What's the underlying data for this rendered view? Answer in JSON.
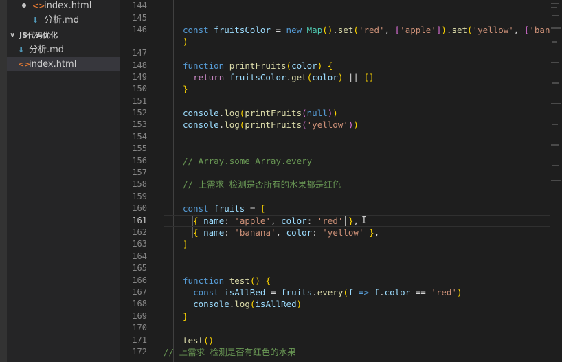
{
  "sidebar": {
    "items": [
      {
        "type": "file",
        "icon": "html-file-icon",
        "label": "index.html",
        "modified": true
      },
      {
        "type": "file",
        "icon": "markdown-file-icon",
        "label": "分析.md"
      },
      {
        "type": "folder",
        "icon": "chevron-down-icon",
        "label": "JS代码优化"
      },
      {
        "type": "file",
        "icon": "markdown-file-icon",
        "label": "分析.md"
      },
      {
        "type": "file",
        "icon": "html-file-icon",
        "label": "index.html",
        "selected": true
      }
    ]
  },
  "editor": {
    "active_line": "161",
    "lines": [
      {
        "n": "144",
        "t": ""
      },
      {
        "n": "145",
        "t": ""
      },
      {
        "n": "146",
        "t": "const fruitsColor = new Map().set('red', ['apple']).set('yellow', ['banana']"
      },
      {
        "n": "",
        "t": ")"
      },
      {
        "n": "147",
        "t": ""
      },
      {
        "n": "148",
        "t": "function printFruits(color) {"
      },
      {
        "n": "149",
        "t": "  return fruitsColor.get(color) || []"
      },
      {
        "n": "150",
        "t": "}"
      },
      {
        "n": "151",
        "t": ""
      },
      {
        "n": "152",
        "t": "console.log(printFruits(null))"
      },
      {
        "n": "153",
        "t": "console.log(printFruits('yellow'))"
      },
      {
        "n": "154",
        "t": ""
      },
      {
        "n": "155",
        "t": ""
      },
      {
        "n": "156",
        "t": "// Array.some Array.every"
      },
      {
        "n": "157",
        "t": ""
      },
      {
        "n": "158",
        "t": "// 上需求 检测是否所有的水果都是红色"
      },
      {
        "n": "159",
        "t": ""
      },
      {
        "n": "160",
        "t": "const fruits = ["
      },
      {
        "n": "161",
        "t": "  { name: 'apple', color: 'red' },"
      },
      {
        "n": "162",
        "t": "  { name: 'banana', color: 'yellow' },"
      },
      {
        "n": "163",
        "t": "]"
      },
      {
        "n": "164",
        "t": ""
      },
      {
        "n": "165",
        "t": ""
      },
      {
        "n": "166",
        "t": "function test() {"
      },
      {
        "n": "167",
        "t": "  const isAllRed = fruits.every(f => f.color == 'red')"
      },
      {
        "n": "168",
        "t": "  console.log(isAllRed)"
      },
      {
        "n": "169",
        "t": "}"
      },
      {
        "n": "170",
        "t": ""
      },
      {
        "n": "171",
        "t": "test()"
      },
      {
        "n": "172",
        "t": "// 上需求 检测是否有红色的水果"
      }
    ]
  },
  "colors": {
    "keyword": "#569cd6",
    "variable": "#9cdcfe",
    "function": "#dcdcaa",
    "class": "#4ec9b0",
    "string": "#ce9178",
    "comment": "#6a9955",
    "bracket_gold": "#ffd700",
    "bracket_purple": "#da70d6",
    "bracket_blue": "#179fff"
  }
}
